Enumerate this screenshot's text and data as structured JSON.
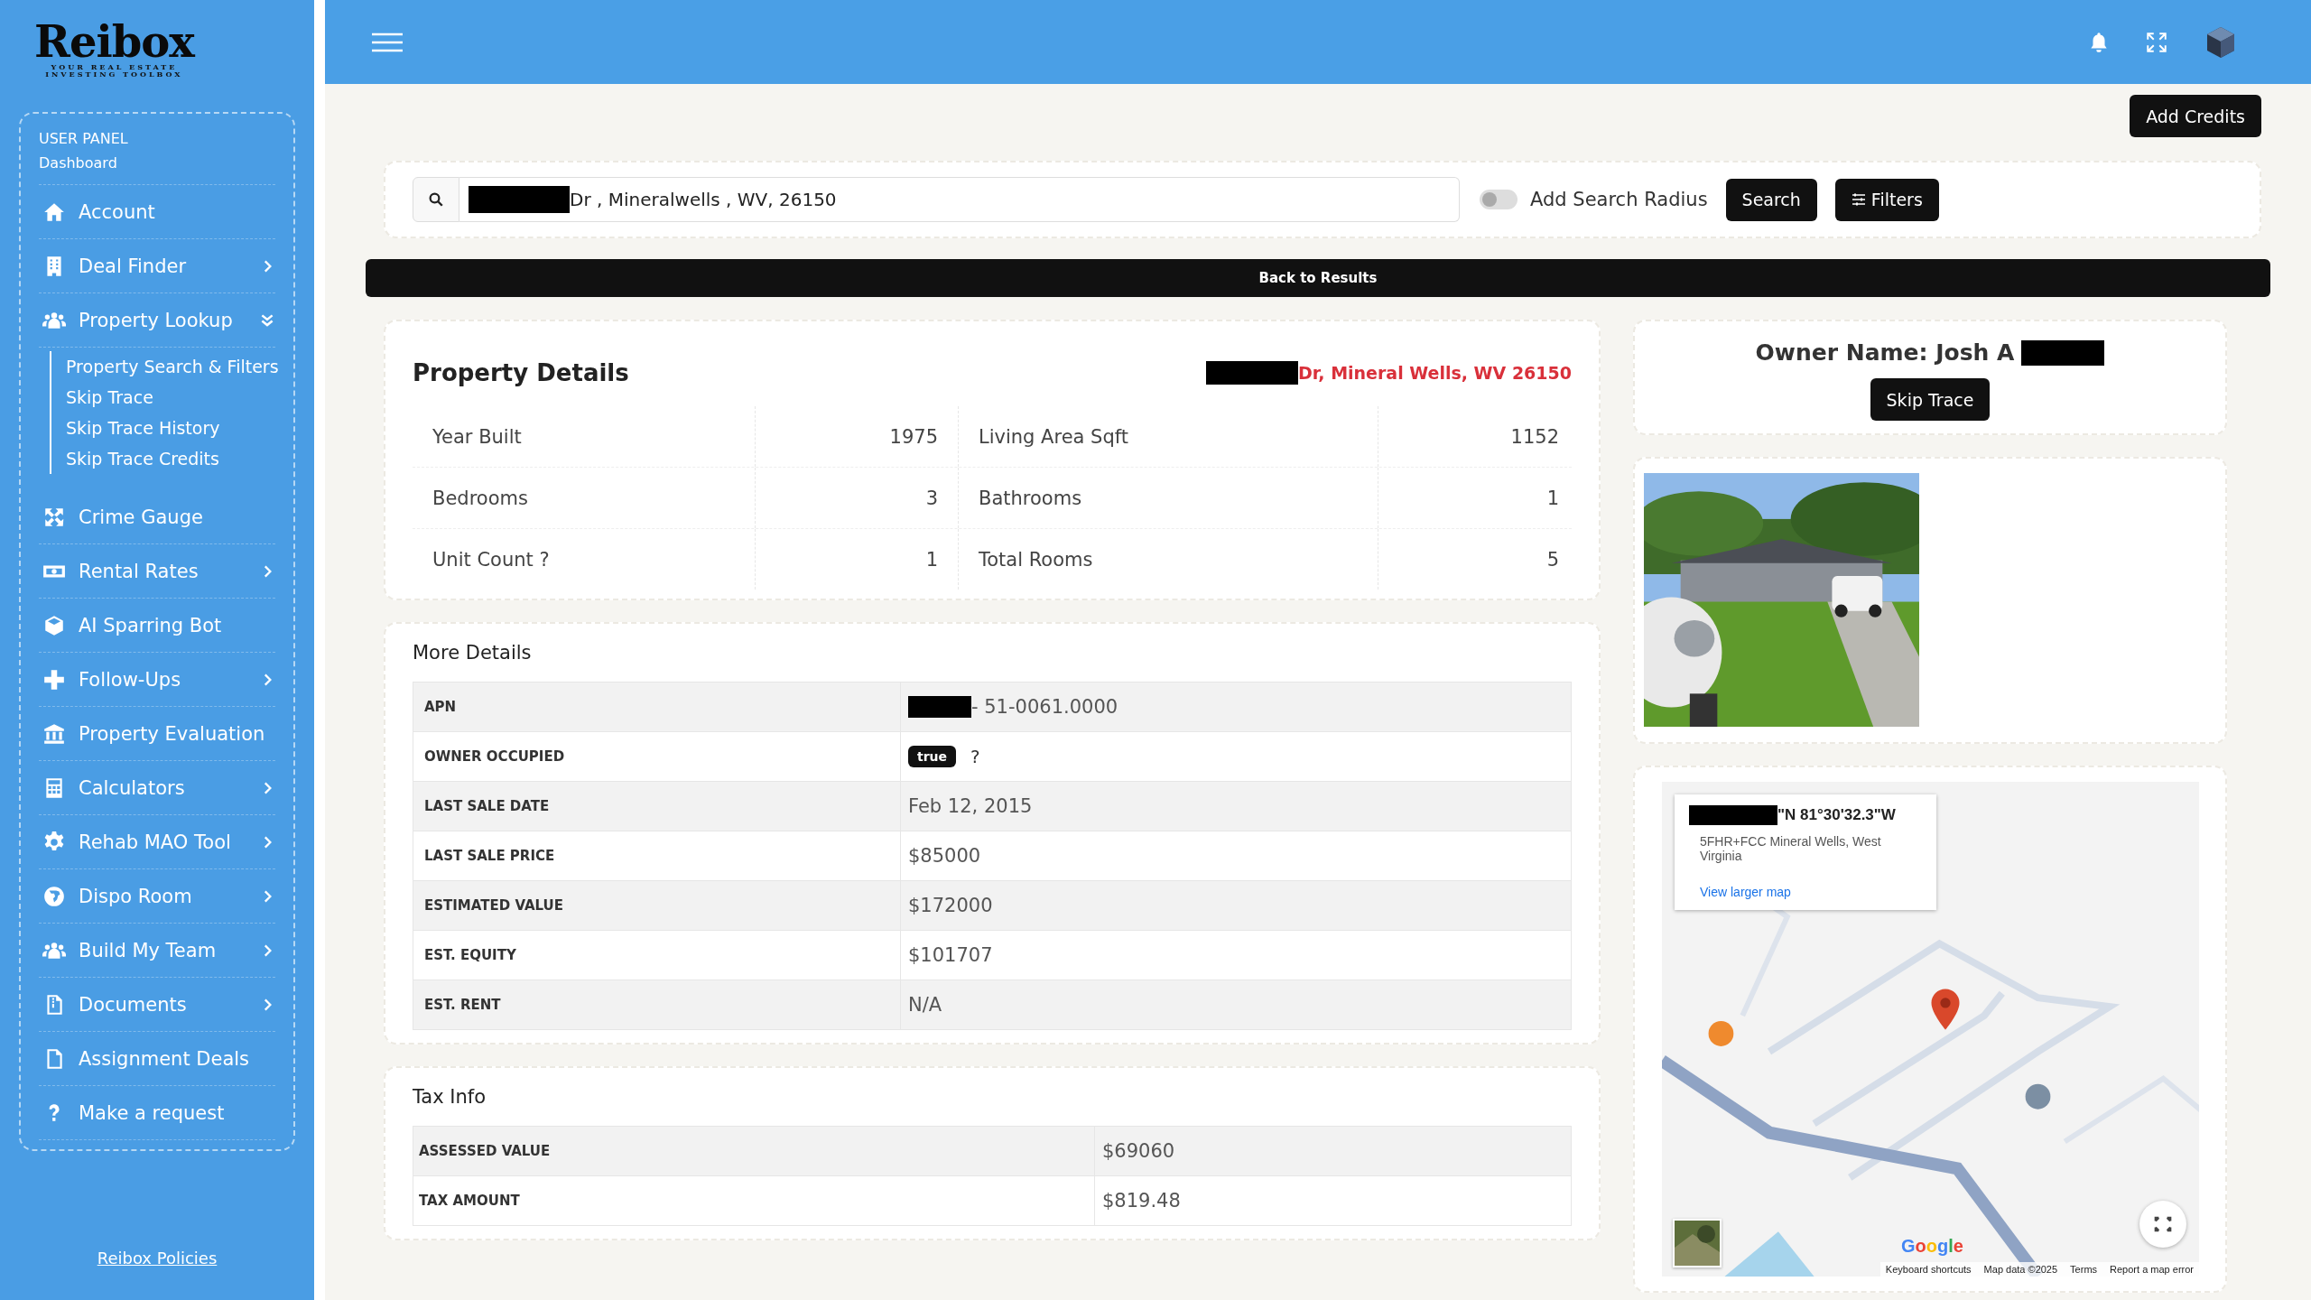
{
  "sidebar": {
    "logo": {
      "name": "Reibox",
      "tagline_1": "YOUR REAL ESTATE",
      "tagline_2": "INVESTING TOOLBOX"
    },
    "panel_title": "USER PANEL",
    "panel_subtitle": "Dashboard",
    "items": [
      {
        "label": "Account",
        "kind": "link"
      },
      {
        "label": "Deal Finder",
        "kind": "group",
        "expanded": false
      },
      {
        "label": "Property Lookup",
        "kind": "group",
        "expanded": true,
        "children": [
          {
            "label": "Property Search & Filters"
          },
          {
            "label": "Skip Trace"
          },
          {
            "label": "Skip Trace History"
          },
          {
            "label": "Skip Trace Credits"
          }
        ]
      },
      {
        "label": "Crime Gauge",
        "kind": "link"
      },
      {
        "label": "Rental Rates",
        "kind": "group",
        "expanded": false
      },
      {
        "label": "AI Sparring Bot",
        "kind": "link"
      },
      {
        "label": "Follow-Ups",
        "kind": "group",
        "expanded": false
      },
      {
        "label": "Property Evaluation",
        "kind": "link"
      },
      {
        "label": "Calculators",
        "kind": "group",
        "expanded": false
      },
      {
        "label": "Rehab MAO Tool",
        "kind": "group",
        "expanded": false
      },
      {
        "label": "Dispo Room",
        "kind": "group",
        "expanded": false
      },
      {
        "label": "Build My Team",
        "kind": "group",
        "expanded": false
      },
      {
        "label": "Documents",
        "kind": "group",
        "expanded": false
      },
      {
        "label": "Assignment Deals",
        "kind": "link"
      },
      {
        "label": "Make a request",
        "kind": "link"
      }
    ],
    "footer_link": "Reibox Policies"
  },
  "add_credits_button": "Add Credits",
  "search": {
    "redacted": true,
    "value": "Dr , Mineralwells , WV, 26150",
    "radius_toggle": {
      "label": "Add Search Radius",
      "on": false
    },
    "search_button": "Search",
    "filters_button": "Filters"
  },
  "back_button": "Back to Results",
  "property_details": {
    "title": "Property Details",
    "address": {
      "redacted": true,
      "text": "Dr, Mineral Wells, WV 26150"
    },
    "rows": [
      [
        {
          "label": "Year Built",
          "value": "1975"
        },
        {
          "label": "Living Area Sqft",
          "value": "1152"
        }
      ],
      [
        {
          "label": "Bedrooms",
          "value": "3"
        },
        {
          "label": "Bathrooms",
          "value": "1"
        }
      ],
      [
        {
          "label": "Unit Count ?",
          "value": "1"
        },
        {
          "label": "Total Rooms",
          "value": "5"
        }
      ]
    ]
  },
  "more_details": {
    "title": "More Details",
    "rows": [
      {
        "label": "APN",
        "kind": "text",
        "redacted": true,
        "value": "- 51-0061.0000"
      },
      {
        "label": "OWNER OCCUPIED",
        "kind": "badge",
        "value": "true",
        "note": "?"
      },
      {
        "label": "LAST SALE DATE",
        "kind": "text",
        "value": "Feb 12, 2015"
      },
      {
        "label": "LAST SALE PRICE",
        "kind": "text",
        "value": "$85000"
      },
      {
        "label": "ESTIMATED VALUE",
        "kind": "text",
        "value": "$172000"
      },
      {
        "label": "EST. EQUITY",
        "kind": "text",
        "value": "$101707"
      },
      {
        "label": "EST. RENT",
        "kind": "text",
        "value": "N/A"
      }
    ]
  },
  "tax_info": {
    "title": "Tax Info",
    "rows": [
      {
        "label": "ASSESSED VALUE",
        "value": "$69060"
      },
      {
        "label": "TAX AMOUNT",
        "value": "$819.48"
      }
    ]
  },
  "owner": {
    "label": "Owner Name: Josh A",
    "redacted": true,
    "button": "Skip Trace"
  },
  "map": {
    "info": {
      "redacted": true,
      "coordinates": "\"N 81°30'32.3\"W",
      "plus_code": "5FHR+FCC Mineral Wells, West Virginia",
      "link": "View larger map"
    },
    "logo": "Google",
    "footer": [
      "Keyboard shortcuts",
      "Map data ©2025",
      "Terms",
      "Report a map error"
    ]
  }
}
